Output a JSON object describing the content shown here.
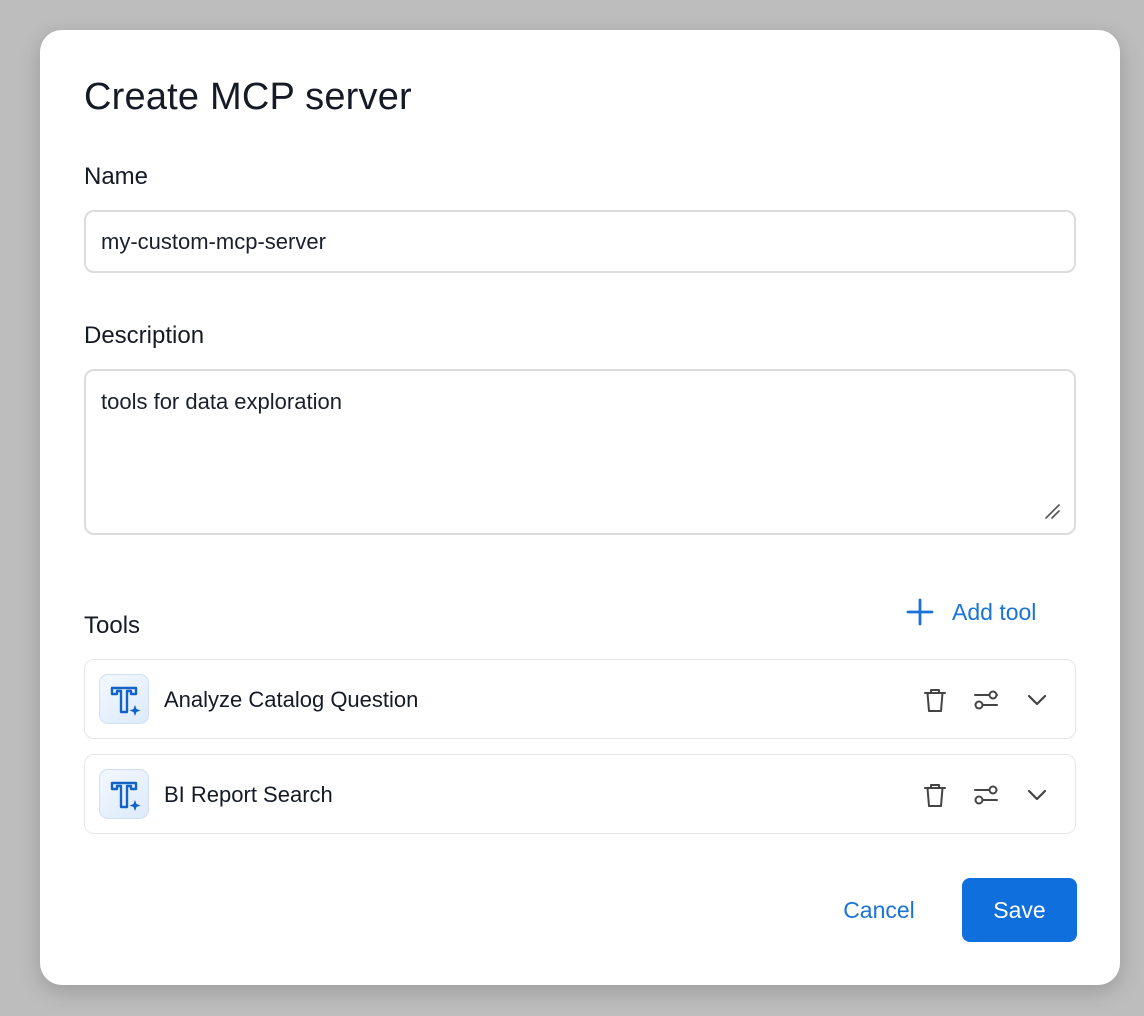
{
  "dialog": {
    "title": "Create MCP server"
  },
  "form": {
    "name_label": "Name",
    "name_value": "my-custom-mcp-server",
    "description_label": "Description",
    "description_value": "tools for data exploration"
  },
  "tools": {
    "label": "Tools",
    "add_label": "Add tool",
    "items": [
      {
        "name": "Analyze Catalog Question",
        "icon": "tool-spark-icon"
      },
      {
        "name": "BI Report Search",
        "icon": "tool-spark-icon"
      }
    ]
  },
  "footer": {
    "cancel_label": "Cancel",
    "save_label": "Save"
  },
  "colors": {
    "accent": "#0f6fdc",
    "link": "#1a73d9",
    "backdrop": "#bdbdbd"
  }
}
